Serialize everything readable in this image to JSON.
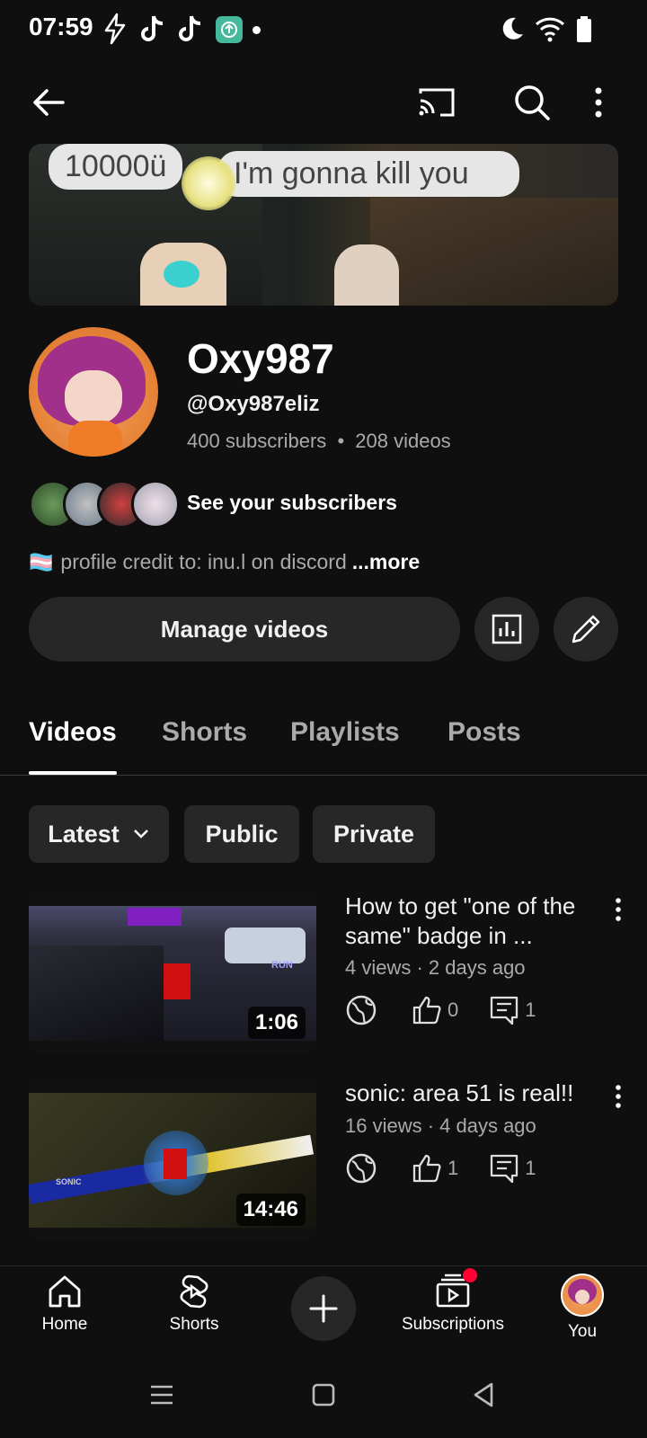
{
  "status_bar": {
    "time": "07:59",
    "icons": [
      "bolt-icon",
      "tiktok-icon",
      "tiktok-icon",
      "app-update-icon",
      "dot-icon",
      "moon-icon",
      "wifi-icon",
      "battery-icon"
    ]
  },
  "top_bar": {
    "icons": [
      "back-arrow-icon",
      "cast-icon",
      "search-icon",
      "more-vert-icon"
    ]
  },
  "banner": {
    "bubble_left": "10000ü",
    "bubble_right": "I'm gonna kill you"
  },
  "channel": {
    "name": "Oxy987",
    "handle": "@Oxy987eliz",
    "subscribers": "400 subscribers",
    "separator": "•",
    "videos": "208 videos",
    "see_subscribers": "See your subscribers",
    "description_flag": "🏳️‍⚧️",
    "description": "profile credit to: inu.l on discord",
    "more": "...more"
  },
  "actions": {
    "manage_videos": "Manage videos",
    "icons": [
      "analytics-icon",
      "edit-pencil-icon"
    ]
  },
  "tabs": [
    {
      "label": "Videos",
      "active": true
    },
    {
      "label": "Shorts",
      "active": false
    },
    {
      "label": "Playlists",
      "active": false
    },
    {
      "label": "Posts",
      "active": false
    }
  ],
  "chips": {
    "latest": "Latest",
    "public": "Public",
    "private": "Private"
  },
  "videos": [
    {
      "title": "How to get \"one of the same\" badge in ...",
      "meta": "4 views · 2 days ago",
      "duration": "1:06",
      "likes": "0",
      "comments": "1",
      "thumb_text": "RUN"
    },
    {
      "title": "sonic: area 51 is real!!",
      "meta": "16 views · 4 days ago",
      "duration": "14:46",
      "likes": "1",
      "comments": "1",
      "thumb_text": "SONIC"
    }
  ],
  "bottom_nav": {
    "home": "Home",
    "shorts": "Shorts",
    "subscriptions": "Subscriptions",
    "you": "You"
  },
  "colors": {
    "background": "#0f0f0f",
    "surface": "#272727",
    "secondary_text": "#aaaaaa",
    "notification_dot": "#ff0033"
  }
}
